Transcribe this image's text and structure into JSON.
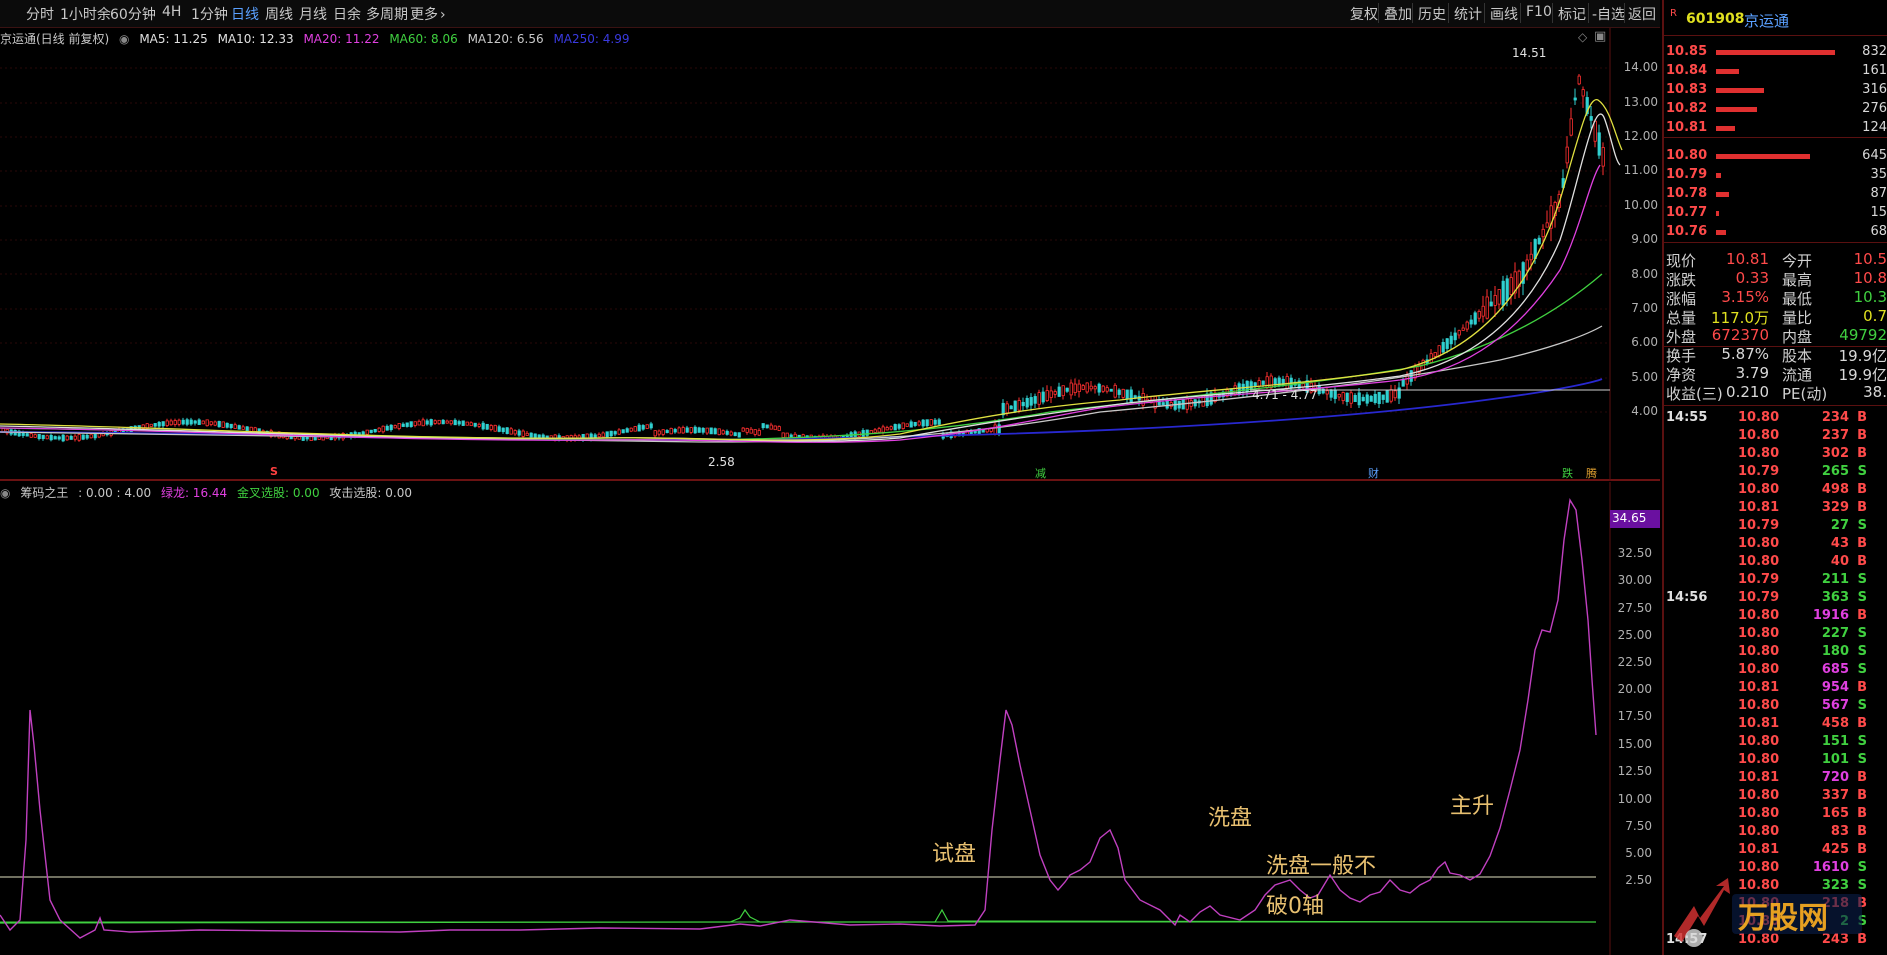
{
  "toolbar": {
    "tabs": [
      {
        "label": "分时"
      },
      {
        "label": "1小时余"
      },
      {
        "label": "60分钟"
      },
      {
        "label": "4H"
      },
      {
        "label": "1分钟"
      },
      {
        "label": "日线"
      },
      {
        "label": "周线"
      },
      {
        "label": "月线"
      },
      {
        "label": "日余"
      },
      {
        "label": "多周期"
      },
      {
        "label": "更多"
      }
    ],
    "more_arrow": "›",
    "active_tab": "日线",
    "right_tools": [
      "复权",
      "叠加",
      "历史",
      "统计",
      "画线",
      "F10",
      "标记",
      "-自选",
      "返回"
    ]
  },
  "main_chart": {
    "stock_label": "京运通(日线 前复权)",
    "ma": [
      {
        "label": "MA5: 11.25",
        "color": "#e0e0e0"
      },
      {
        "label": "MA10: 12.33",
        "color": "#e0e0e0"
      },
      {
        "label": "MA20: 11.22",
        "color": "#e040e0"
      },
      {
        "label": "MA60: 8.06",
        "color": "#40d040"
      },
      {
        "label": "MA120: 6.56",
        "color": "#c8c8c8"
      },
      {
        "label": "MA250: 4.99",
        "color": "#2828d0"
      }
    ],
    "price_axis": [
      "14.00",
      "13.00",
      "12.00",
      "11.00",
      "10.00",
      "9.00",
      "8.00",
      "7.00",
      "6.00",
      "5.00",
      "4.00"
    ],
    "high_mark": "14.51",
    "low_mark": "2.58",
    "range_label": "4.71 - 4.77",
    "event_marks": [
      "S",
      "减",
      "财",
      "跌",
      "腾"
    ]
  },
  "indicator": {
    "name": "筹码之王",
    "values": [
      {
        "label": ": 0.00 : 4.00",
        "color": "#c8c8c8"
      },
      {
        "label": "绿龙: 16.44",
        "color": "#e040e0"
      },
      {
        "label": "金叉选股: 0.00",
        "color": "#40d040"
      },
      {
        "label": "攻击选股: 0.00",
        "color": "#c8c8c8"
      }
    ],
    "current_value": "34.65",
    "axis": [
      "32.50",
      "30.00",
      "27.50",
      "25.00",
      "22.50",
      "20.00",
      "17.50",
      "15.00",
      "12.50",
      "10.00",
      "7.50",
      "5.00",
      "2.50"
    ],
    "annotations": [
      {
        "text": "试盘"
      },
      {
        "text": "洗盘"
      },
      {
        "text": "洗盘一般不"
      },
      {
        "text": "破0轴"
      },
      {
        "text": "主升"
      }
    ]
  },
  "right_panel": {
    "code_prefix": "R",
    "code": "601908",
    "name": "京运通",
    "sell_orders": [
      {
        "price": "10.85",
        "vol": "832",
        "fill": 0.95
      },
      {
        "price": "10.84",
        "vol": "161",
        "fill": 0.18
      },
      {
        "price": "10.83",
        "vol": "316",
        "fill": 0.38
      },
      {
        "price": "10.82",
        "vol": "276",
        "fill": 0.33
      },
      {
        "price": "10.81",
        "vol": "124",
        "fill": 0.15
      }
    ],
    "buy_orders": [
      {
        "price": "10.80",
        "vol": "645",
        "fill": 0.75
      },
      {
        "price": "10.79",
        "vol": "35",
        "fill": 0.04
      },
      {
        "price": "10.78",
        "vol": "87",
        "fill": 0.1
      },
      {
        "price": "10.77",
        "vol": "15",
        "fill": 0.02
      },
      {
        "price": "10.76",
        "vol": "68",
        "fill": 0.08
      }
    ],
    "quotes": [
      {
        "l": "现价",
        "v": "10.81",
        "vc": "#ff4a4a",
        "l2": "今开",
        "v2": "10.5",
        "v2c": "#ff4a4a"
      },
      {
        "l": "涨跌",
        "v": "0.33",
        "vc": "#ff4a4a",
        "l2": "最高",
        "v2": "10.8",
        "v2c": "#ff4a4a"
      },
      {
        "l": "涨幅",
        "v": "3.15%",
        "vc": "#ff4a4a",
        "l2": "最低",
        "v2": "10.3",
        "v2c": "#40d040"
      },
      {
        "l": "总量",
        "v": "117.0万",
        "vc": "#e0e020",
        "l2": "量比",
        "v2": "0.7",
        "v2c": "#e0e020"
      },
      {
        "l": "外盘",
        "v": "672370",
        "vc": "#ff4a4a",
        "l2": "内盘",
        "v2": "49792",
        "v2c": "#40d040"
      },
      {
        "l": "换手",
        "v": "5.87%",
        "vc": "#d8d8d8",
        "l2": "股本",
        "v2": "19.9亿",
        "v2c": "#d8d8d8"
      },
      {
        "l": "净资",
        "v": "3.79",
        "vc": "#d8d8d8",
        "l2": "流通",
        "v2": "19.9亿",
        "v2c": "#d8d8d8"
      },
      {
        "l": "收益(三)",
        "v": "0.210",
        "vc": "#d8d8d8",
        "l2": "PE(动)",
        "v2": "38.",
        "v2c": "#d8d8d8"
      }
    ],
    "ticks": [
      {
        "t": "14:55",
        "p": "10.80",
        "v": "234",
        "bs": "B",
        "vc": "#ff4a4a"
      },
      {
        "t": "",
        "p": "10.80",
        "v": "237",
        "bs": "B",
        "vc": "#ff4a4a"
      },
      {
        "t": "",
        "p": "10.80",
        "v": "302",
        "bs": "B",
        "vc": "#ff4a4a"
      },
      {
        "t": "",
        "p": "10.79",
        "v": "265",
        "bs": "S",
        "vc": "#40d040"
      },
      {
        "t": "",
        "p": "10.80",
        "v": "498",
        "bs": "B",
        "vc": "#ff4a4a"
      },
      {
        "t": "",
        "p": "10.81",
        "v": "329",
        "bs": "B",
        "vc": "#ff4a4a"
      },
      {
        "t": "",
        "p": "10.79",
        "v": "27",
        "bs": "S",
        "vc": "#40d040"
      },
      {
        "t": "",
        "p": "10.80",
        "v": "43",
        "bs": "B",
        "vc": "#ff4a4a"
      },
      {
        "t": "",
        "p": "10.80",
        "v": "40",
        "bs": "B",
        "vc": "#ff4a4a"
      },
      {
        "t": "",
        "p": "10.79",
        "v": "211",
        "bs": "S",
        "vc": "#40d040"
      },
      {
        "t": "14:56",
        "p": "10.79",
        "v": "363",
        "bs": "S",
        "vc": "#40d040"
      },
      {
        "t": "",
        "p": "10.80",
        "v": "1916",
        "bs": "B",
        "vc": "#e040e0"
      },
      {
        "t": "",
        "p": "10.80",
        "v": "227",
        "bs": "S",
        "vc": "#40d040"
      },
      {
        "t": "",
        "p": "10.80",
        "v": "180",
        "bs": "S",
        "vc": "#40d040"
      },
      {
        "t": "",
        "p": "10.80",
        "v": "685",
        "bs": "S",
        "vc": "#e040e0"
      },
      {
        "t": "",
        "p": "10.81",
        "v": "954",
        "bs": "B",
        "vc": "#e040e0"
      },
      {
        "t": "",
        "p": "10.80",
        "v": "567",
        "bs": "S",
        "vc": "#e040e0"
      },
      {
        "t": "",
        "p": "10.81",
        "v": "458",
        "bs": "B",
        "vc": "#ff4a4a"
      },
      {
        "t": "",
        "p": "10.80",
        "v": "151",
        "bs": "S",
        "vc": "#40d040"
      },
      {
        "t": "",
        "p": "10.80",
        "v": "101",
        "bs": "S",
        "vc": "#40d040"
      },
      {
        "t": "",
        "p": "10.81",
        "v": "720",
        "bs": "B",
        "vc": "#e040e0"
      },
      {
        "t": "",
        "p": "10.80",
        "v": "337",
        "bs": "B",
        "vc": "#ff4a4a"
      },
      {
        "t": "",
        "p": "10.80",
        "v": "165",
        "bs": "B",
        "vc": "#ff4a4a"
      },
      {
        "t": "",
        "p": "10.80",
        "v": "83",
        "bs": "B",
        "vc": "#ff4a4a"
      },
      {
        "t": "",
        "p": "10.81",
        "v": "425",
        "bs": "B",
        "vc": "#ff4a4a"
      },
      {
        "t": "",
        "p": "10.80",
        "v": "1610",
        "bs": "S",
        "vc": "#e040e0"
      },
      {
        "t": "",
        "p": "10.80",
        "v": "323",
        "bs": "S",
        "vc": "#40d040"
      },
      {
        "t": "",
        "p": "10.80",
        "v": "218",
        "bs": "B",
        "vc": "#ff4a4a"
      },
      {
        "t": "",
        "p": "10.80",
        "v": "2",
        "bs": "S",
        "vc": "#40d040"
      },
      {
        "t": "14:57",
        "p": "10.80",
        "v": "243",
        "bs": "B",
        "vc": "#ff4a4a"
      }
    ]
  }
}
